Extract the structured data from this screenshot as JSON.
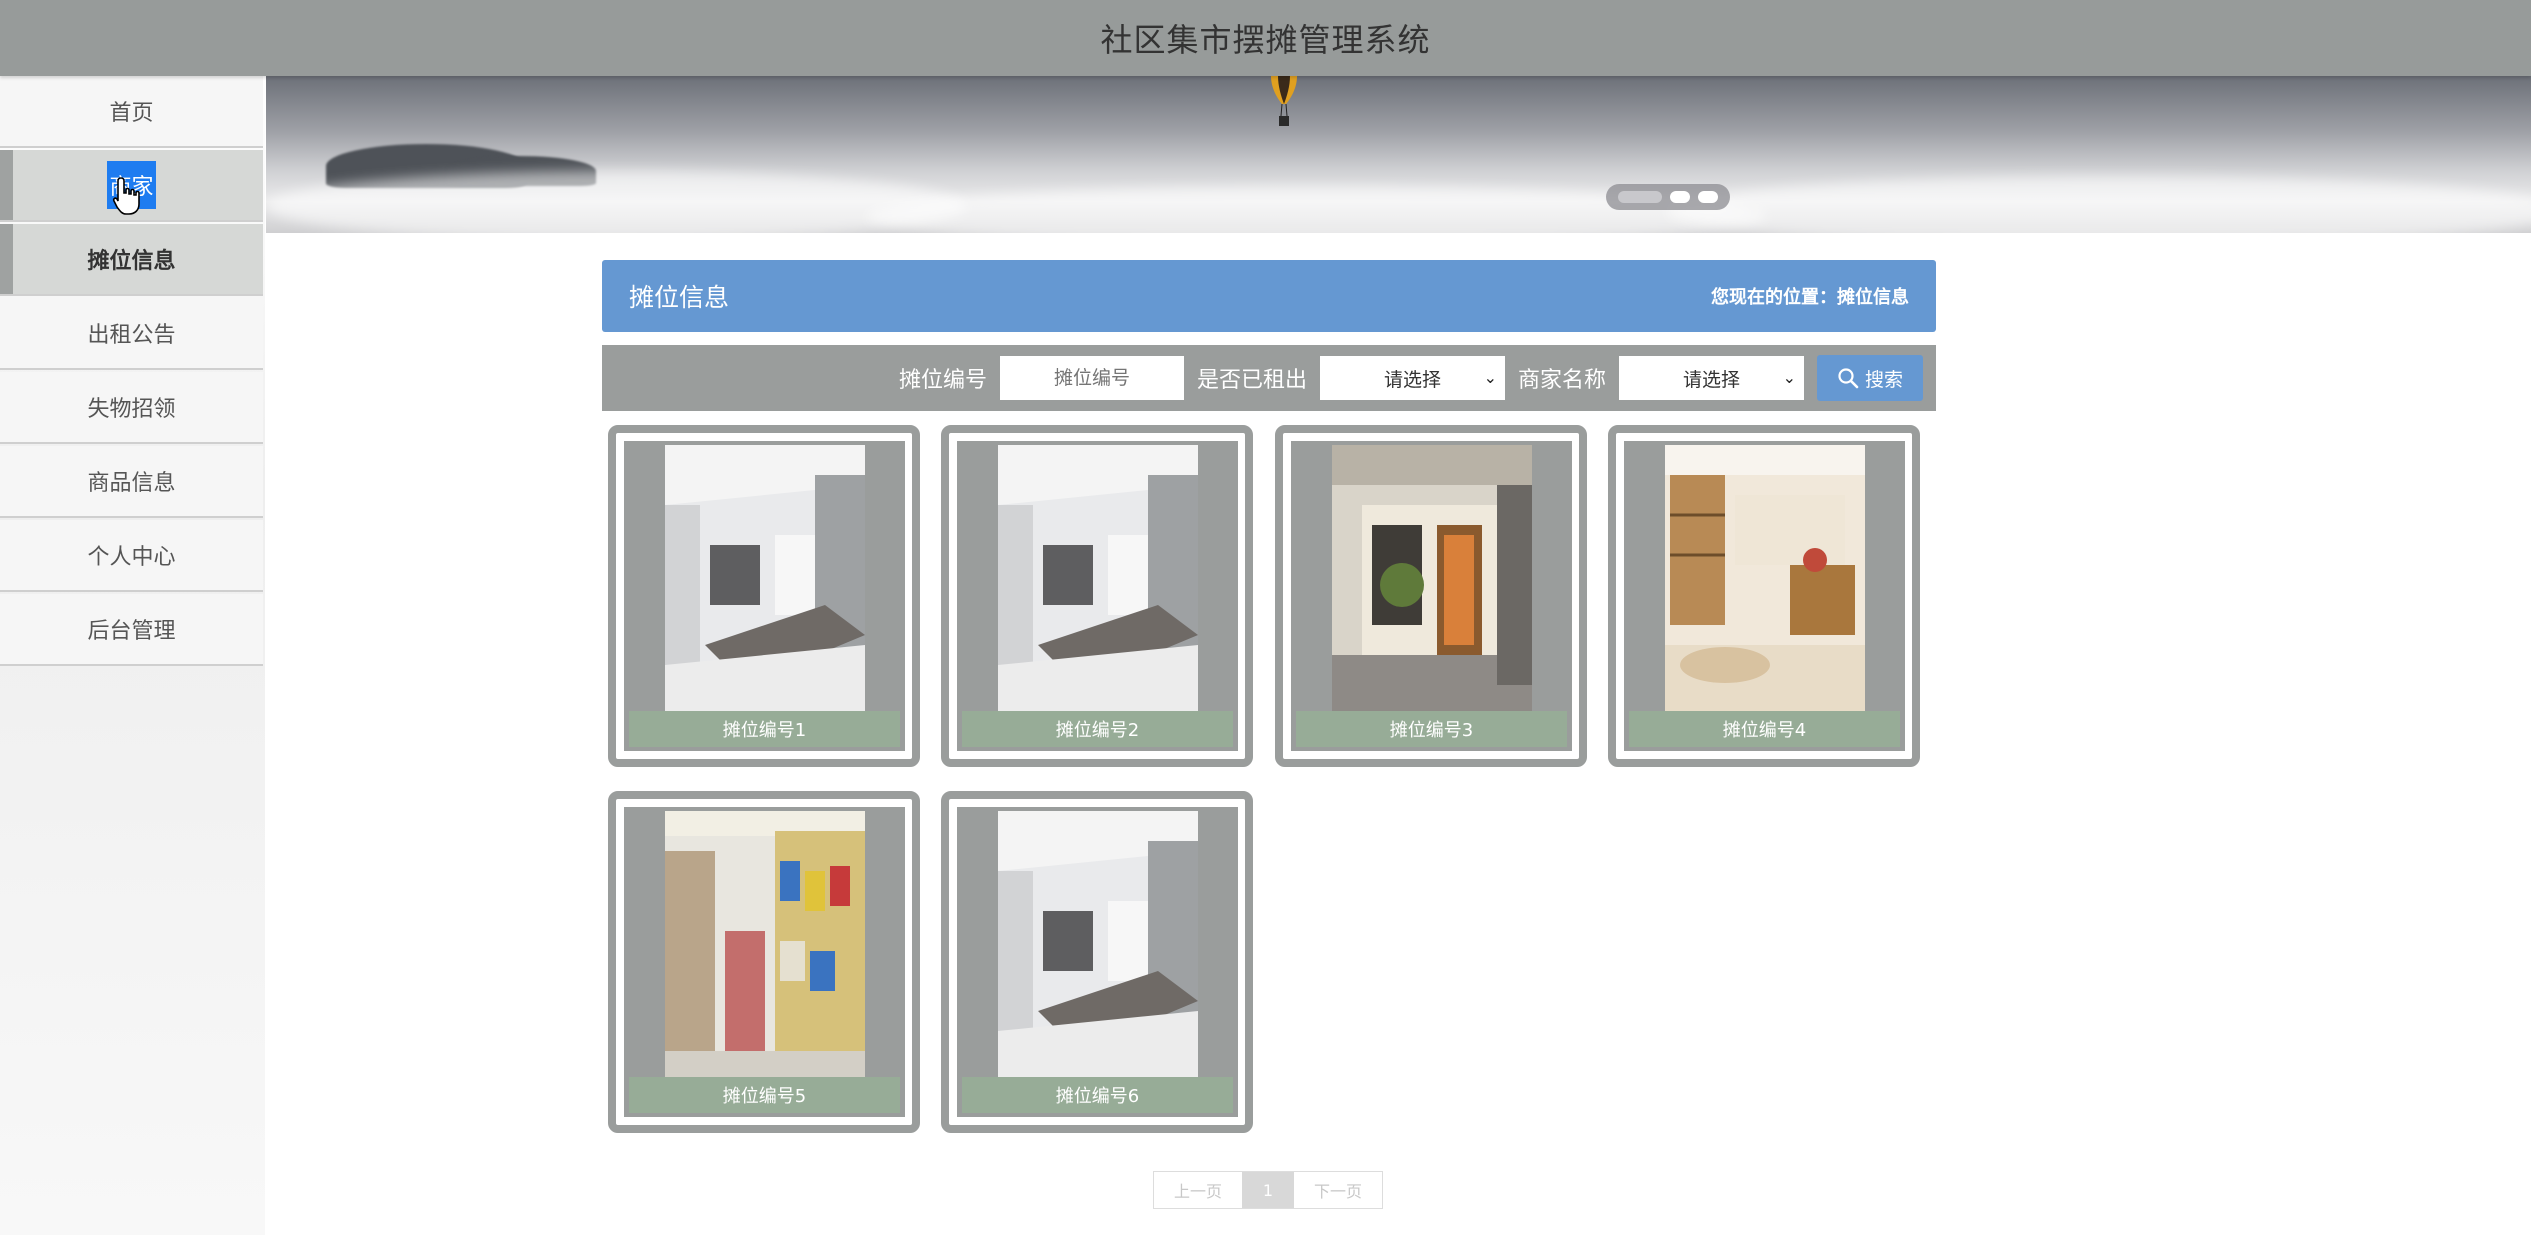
{
  "header": {
    "title": "社区集市摆摊管理系统"
  },
  "sidebar": {
    "items": [
      {
        "label": "首页"
      },
      {
        "label": "商家"
      },
      {
        "label": "摊位信息"
      },
      {
        "label": "出租公告"
      },
      {
        "label": "失物招领"
      },
      {
        "label": "商品信息"
      },
      {
        "label": "个人中心"
      },
      {
        "label": "后台管理"
      }
    ]
  },
  "banner": {
    "active_slide": 1
  },
  "main": {
    "title": "摊位信息",
    "location_prefix": "您现在的位置：",
    "location": "摊位信息"
  },
  "search": {
    "stall_no_label": "摊位编号",
    "stall_no_placeholder": "摊位编号",
    "rented_label": "是否已租出",
    "rented_value": "请选择",
    "merchant_label": "商家名称",
    "merchant_value": "请选择",
    "button_label": "搜索"
  },
  "stalls": [
    {
      "name": "摊位编号1",
      "image": "interior-gray"
    },
    {
      "name": "摊位编号2",
      "image": "interior-gray"
    },
    {
      "name": "摊位编号3",
      "image": "storefront"
    },
    {
      "name": "摊位编号4",
      "image": "wooden-shop"
    },
    {
      "name": "摊位编号5",
      "image": "supermarket"
    },
    {
      "name": "摊位编号6",
      "image": "interior-gray"
    }
  ],
  "pagination": {
    "prev": "上一页",
    "current": "1",
    "next": "下一页"
  },
  "colors": {
    "header": "#979b9a",
    "accent": "#6598d2",
    "caption": "#97ac97",
    "frame": "#9a9d9c"
  }
}
